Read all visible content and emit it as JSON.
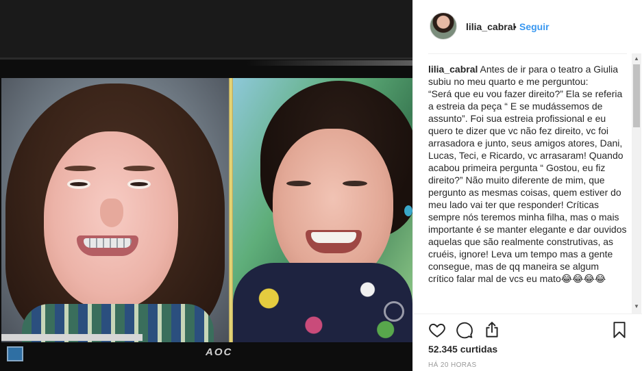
{
  "post": {
    "header": {
      "username": "lilia_cabral",
      "separator": "•",
      "follow_label": "Seguir"
    },
    "caption": {
      "author": "lilia_cabral",
      "text": " Antes de ir para o teatro a Giulia subiu no meu quarto e me perguntou:\n“Será que eu vou fazer direito?” Ela se referia a estreia da peça “ E se mudássemos de assunto”. Foi sua estreia profissional e eu quero te dizer que vc não fez direito, vc foi arrasadora e junto, seus amigos atores, Dani, Lucas, Teci, e Ricardo, vc arrasaram! Quando acabou primeira pergunta “ Gostou, eu fiz direito?” Não muito diferente de mim, que pergunto as mesmas coisas, quem estiver do meu lado vai ter que responder! Críticas sempre nós teremos minha filha, mas o mais importante é se manter elegante e dar ouvidos aquelas que são realmente construtivas, as cruéis, ignore! Leva um tempo mas a gente consegue, mas de qq maneira se algum crítico falar mal de vcs eu mato😂😂😂😂"
    },
    "likes": "52.345 curtidas",
    "time": "HÁ 20 HORAS",
    "monitor_brand": "AOC"
  },
  "icons": {
    "heart": "heart-icon",
    "comment": "comment-icon",
    "share": "share-icon",
    "save": "bookmark-icon"
  },
  "colors": {
    "link": "#3897f0",
    "text": "#262626",
    "muted": "#999999"
  }
}
